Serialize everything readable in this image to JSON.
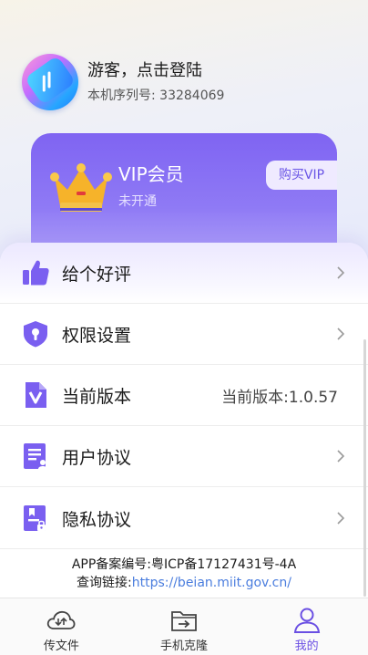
{
  "profile": {
    "login_text": "游客，点击登陆",
    "serial_label": "本机序列号:",
    "serial_value": "33284069"
  },
  "vip": {
    "title": "VIP会员",
    "status": "未开通",
    "buy_label": "购买VIP"
  },
  "menu": [
    {
      "label": "给个好评",
      "icon": "thumbs-up-icon"
    },
    {
      "label": "权限设置",
      "icon": "shield-lock-icon"
    },
    {
      "label": "当前版本",
      "icon": "version-file-icon",
      "value": "当前版本:1.0.57"
    },
    {
      "label": "用户协议",
      "icon": "user-agreement-icon"
    },
    {
      "label": "隐私协议",
      "icon": "privacy-document-icon"
    }
  ],
  "filing": {
    "record": "APP备案编号:粤ICP备17127431号-4A",
    "link_label": "查询链接:",
    "link_url": "https://beian.miit.gov.cn/"
  },
  "tabs": [
    {
      "label": "传文件",
      "icon": "cloud-transfer-icon"
    },
    {
      "label": "手机克隆",
      "icon": "folder-import-icon"
    },
    {
      "label": "我的",
      "icon": "user-profile-icon",
      "active": true
    }
  ],
  "colors": {
    "accent": "#7a5ff0",
    "vip_gradient_top": "#7f64f2",
    "vip_gradient_bottom": "#b9aefb",
    "crown": "#f5b028",
    "link": "#4a7dde"
  }
}
